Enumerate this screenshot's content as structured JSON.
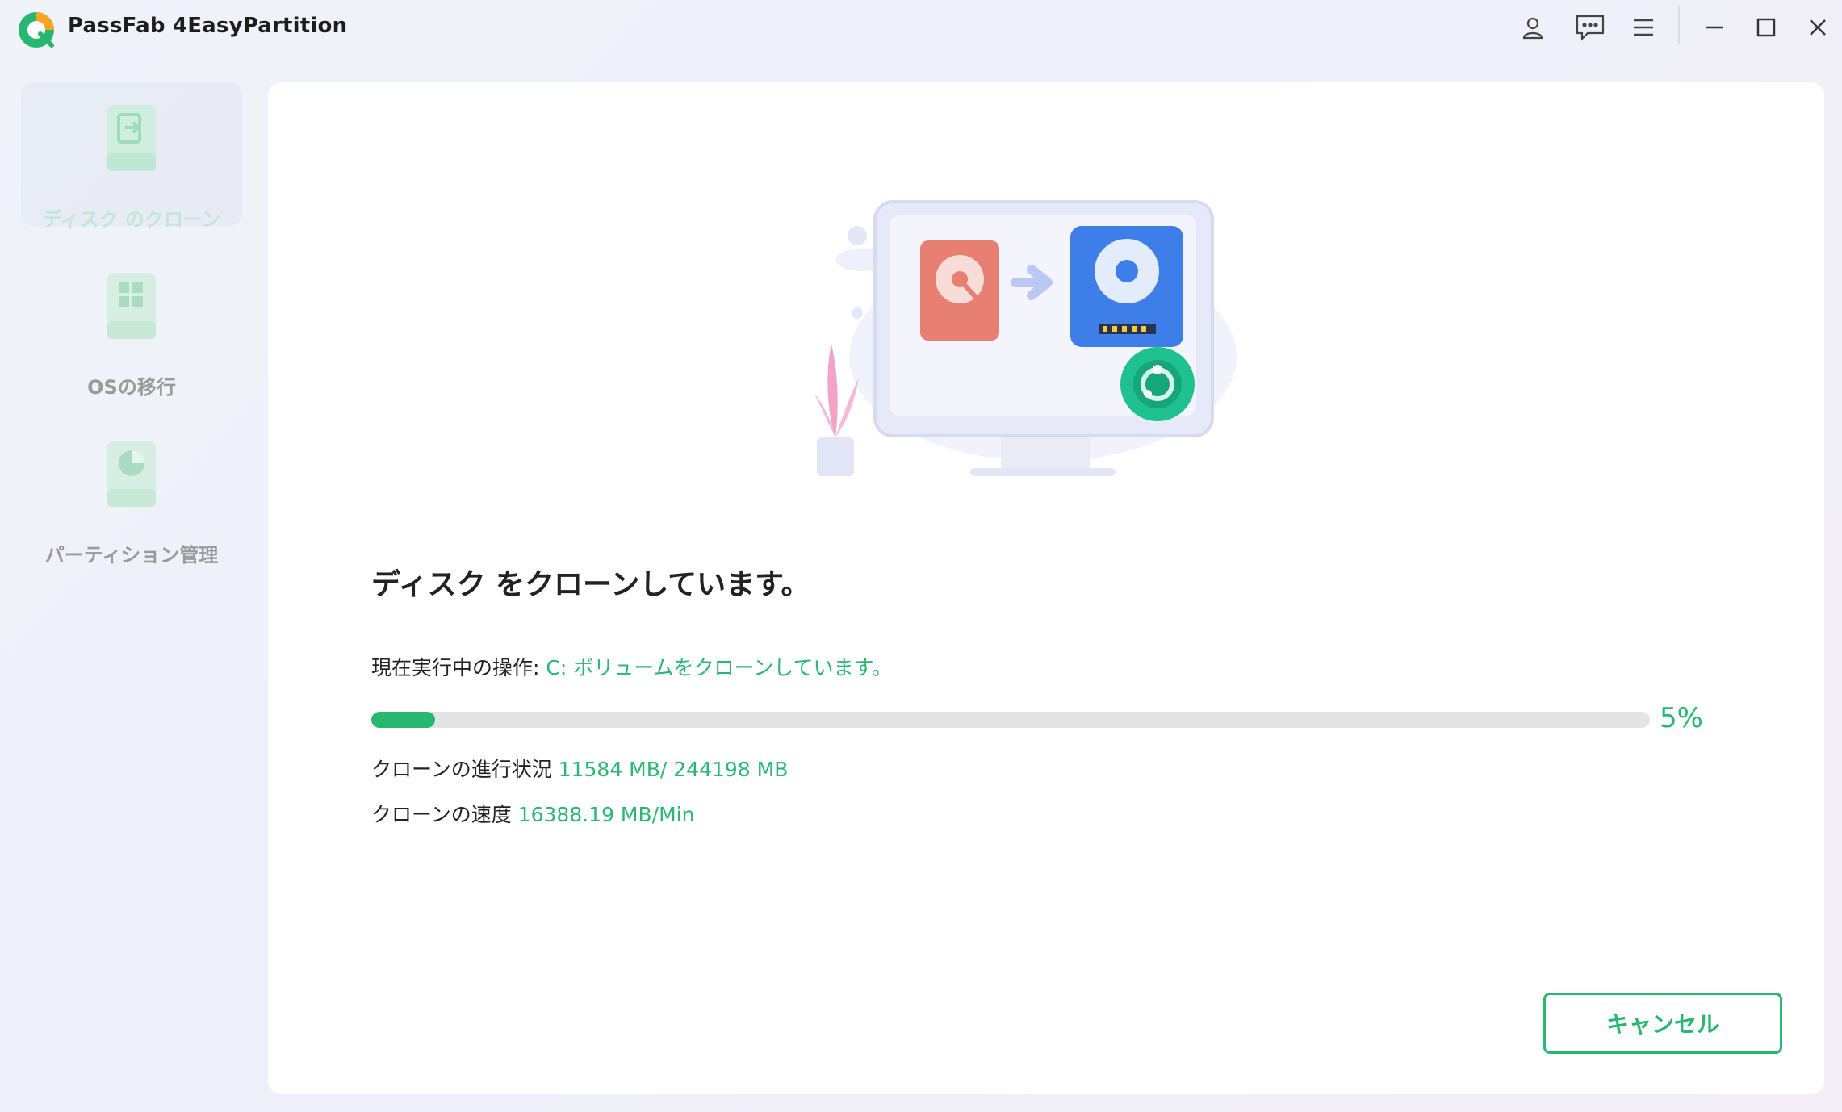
{
  "app": {
    "title": "PassFab 4EasyPartition"
  },
  "titlebar_icons": [
    "user-icon",
    "feedback-icon",
    "menu-icon",
    "minimize-icon",
    "maximize-icon",
    "close-icon"
  ],
  "sidebar": {
    "items": [
      {
        "label": "ディスク のクローン",
        "icon": "disk-clone-icon",
        "active": true
      },
      {
        "label": "OSの移行",
        "icon": "os-migration-icon",
        "active": false
      },
      {
        "label": "パーティション管理",
        "icon": "partition-management-icon",
        "active": false
      }
    ]
  },
  "main": {
    "heading": "ディスク をクローンしています。",
    "operation_label": "現在実行中の操作: ",
    "operation_value": "C: ボリュームをクローンしています。",
    "progress_percent": 5,
    "progress_text": "5%",
    "clone_progress_label": "クローンの進行状況 ",
    "clone_progress_value": "11584 MB/ 244198 MB",
    "clone_speed_label": "クローンの速度 ",
    "clone_speed_value": "16388.19 MB/Min",
    "cancel_label": "キャンセル"
  },
  "colors": {
    "accent": "#27b770",
    "source_disk": "#e77f72",
    "target_disk": "#3d7ee8"
  }
}
